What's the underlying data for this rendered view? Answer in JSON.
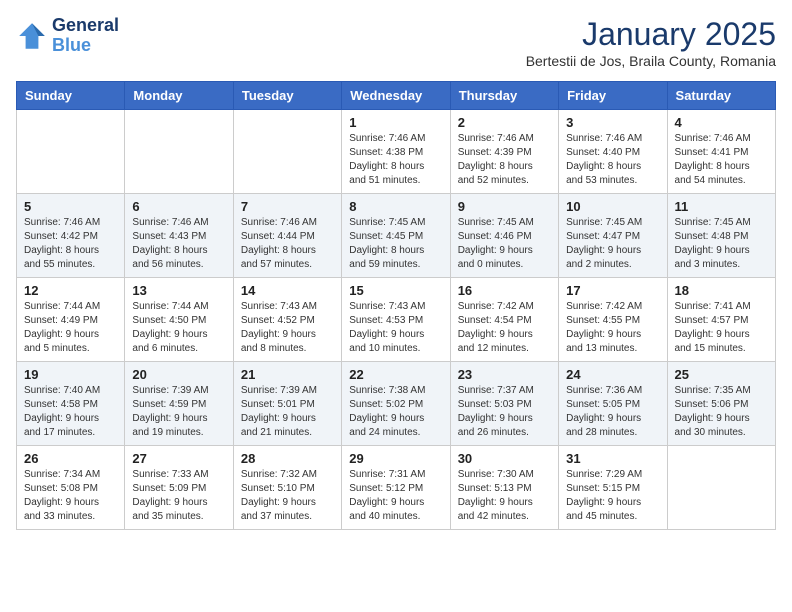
{
  "header": {
    "logo_line1": "General",
    "logo_line2": "Blue",
    "month": "January 2025",
    "location": "Bertestii de Jos, Braila County, Romania"
  },
  "weekdays": [
    "Sunday",
    "Monday",
    "Tuesday",
    "Wednesday",
    "Thursday",
    "Friday",
    "Saturday"
  ],
  "weeks": [
    [
      {
        "day": "",
        "info": ""
      },
      {
        "day": "",
        "info": ""
      },
      {
        "day": "",
        "info": ""
      },
      {
        "day": "1",
        "info": "Sunrise: 7:46 AM\nSunset: 4:38 PM\nDaylight: 8 hours and 51 minutes."
      },
      {
        "day": "2",
        "info": "Sunrise: 7:46 AM\nSunset: 4:39 PM\nDaylight: 8 hours and 52 minutes."
      },
      {
        "day": "3",
        "info": "Sunrise: 7:46 AM\nSunset: 4:40 PM\nDaylight: 8 hours and 53 minutes."
      },
      {
        "day": "4",
        "info": "Sunrise: 7:46 AM\nSunset: 4:41 PM\nDaylight: 8 hours and 54 minutes."
      }
    ],
    [
      {
        "day": "5",
        "info": "Sunrise: 7:46 AM\nSunset: 4:42 PM\nDaylight: 8 hours and 55 minutes."
      },
      {
        "day": "6",
        "info": "Sunrise: 7:46 AM\nSunset: 4:43 PM\nDaylight: 8 hours and 56 minutes."
      },
      {
        "day": "7",
        "info": "Sunrise: 7:46 AM\nSunset: 4:44 PM\nDaylight: 8 hours and 57 minutes."
      },
      {
        "day": "8",
        "info": "Sunrise: 7:45 AM\nSunset: 4:45 PM\nDaylight: 8 hours and 59 minutes."
      },
      {
        "day": "9",
        "info": "Sunrise: 7:45 AM\nSunset: 4:46 PM\nDaylight: 9 hours and 0 minutes."
      },
      {
        "day": "10",
        "info": "Sunrise: 7:45 AM\nSunset: 4:47 PM\nDaylight: 9 hours and 2 minutes."
      },
      {
        "day": "11",
        "info": "Sunrise: 7:45 AM\nSunset: 4:48 PM\nDaylight: 9 hours and 3 minutes."
      }
    ],
    [
      {
        "day": "12",
        "info": "Sunrise: 7:44 AM\nSunset: 4:49 PM\nDaylight: 9 hours and 5 minutes."
      },
      {
        "day": "13",
        "info": "Sunrise: 7:44 AM\nSunset: 4:50 PM\nDaylight: 9 hours and 6 minutes."
      },
      {
        "day": "14",
        "info": "Sunrise: 7:43 AM\nSunset: 4:52 PM\nDaylight: 9 hours and 8 minutes."
      },
      {
        "day": "15",
        "info": "Sunrise: 7:43 AM\nSunset: 4:53 PM\nDaylight: 9 hours and 10 minutes."
      },
      {
        "day": "16",
        "info": "Sunrise: 7:42 AM\nSunset: 4:54 PM\nDaylight: 9 hours and 12 minutes."
      },
      {
        "day": "17",
        "info": "Sunrise: 7:42 AM\nSunset: 4:55 PM\nDaylight: 9 hours and 13 minutes."
      },
      {
        "day": "18",
        "info": "Sunrise: 7:41 AM\nSunset: 4:57 PM\nDaylight: 9 hours and 15 minutes."
      }
    ],
    [
      {
        "day": "19",
        "info": "Sunrise: 7:40 AM\nSunset: 4:58 PM\nDaylight: 9 hours and 17 minutes."
      },
      {
        "day": "20",
        "info": "Sunrise: 7:39 AM\nSunset: 4:59 PM\nDaylight: 9 hours and 19 minutes."
      },
      {
        "day": "21",
        "info": "Sunrise: 7:39 AM\nSunset: 5:01 PM\nDaylight: 9 hours and 21 minutes."
      },
      {
        "day": "22",
        "info": "Sunrise: 7:38 AM\nSunset: 5:02 PM\nDaylight: 9 hours and 24 minutes."
      },
      {
        "day": "23",
        "info": "Sunrise: 7:37 AM\nSunset: 5:03 PM\nDaylight: 9 hours and 26 minutes."
      },
      {
        "day": "24",
        "info": "Sunrise: 7:36 AM\nSunset: 5:05 PM\nDaylight: 9 hours and 28 minutes."
      },
      {
        "day": "25",
        "info": "Sunrise: 7:35 AM\nSunset: 5:06 PM\nDaylight: 9 hours and 30 minutes."
      }
    ],
    [
      {
        "day": "26",
        "info": "Sunrise: 7:34 AM\nSunset: 5:08 PM\nDaylight: 9 hours and 33 minutes."
      },
      {
        "day": "27",
        "info": "Sunrise: 7:33 AM\nSunset: 5:09 PM\nDaylight: 9 hours and 35 minutes."
      },
      {
        "day": "28",
        "info": "Sunrise: 7:32 AM\nSunset: 5:10 PM\nDaylight: 9 hours and 37 minutes."
      },
      {
        "day": "29",
        "info": "Sunrise: 7:31 AM\nSunset: 5:12 PM\nDaylight: 9 hours and 40 minutes."
      },
      {
        "day": "30",
        "info": "Sunrise: 7:30 AM\nSunset: 5:13 PM\nDaylight: 9 hours and 42 minutes."
      },
      {
        "day": "31",
        "info": "Sunrise: 7:29 AM\nSunset: 5:15 PM\nDaylight: 9 hours and 45 minutes."
      },
      {
        "day": "",
        "info": ""
      }
    ]
  ]
}
